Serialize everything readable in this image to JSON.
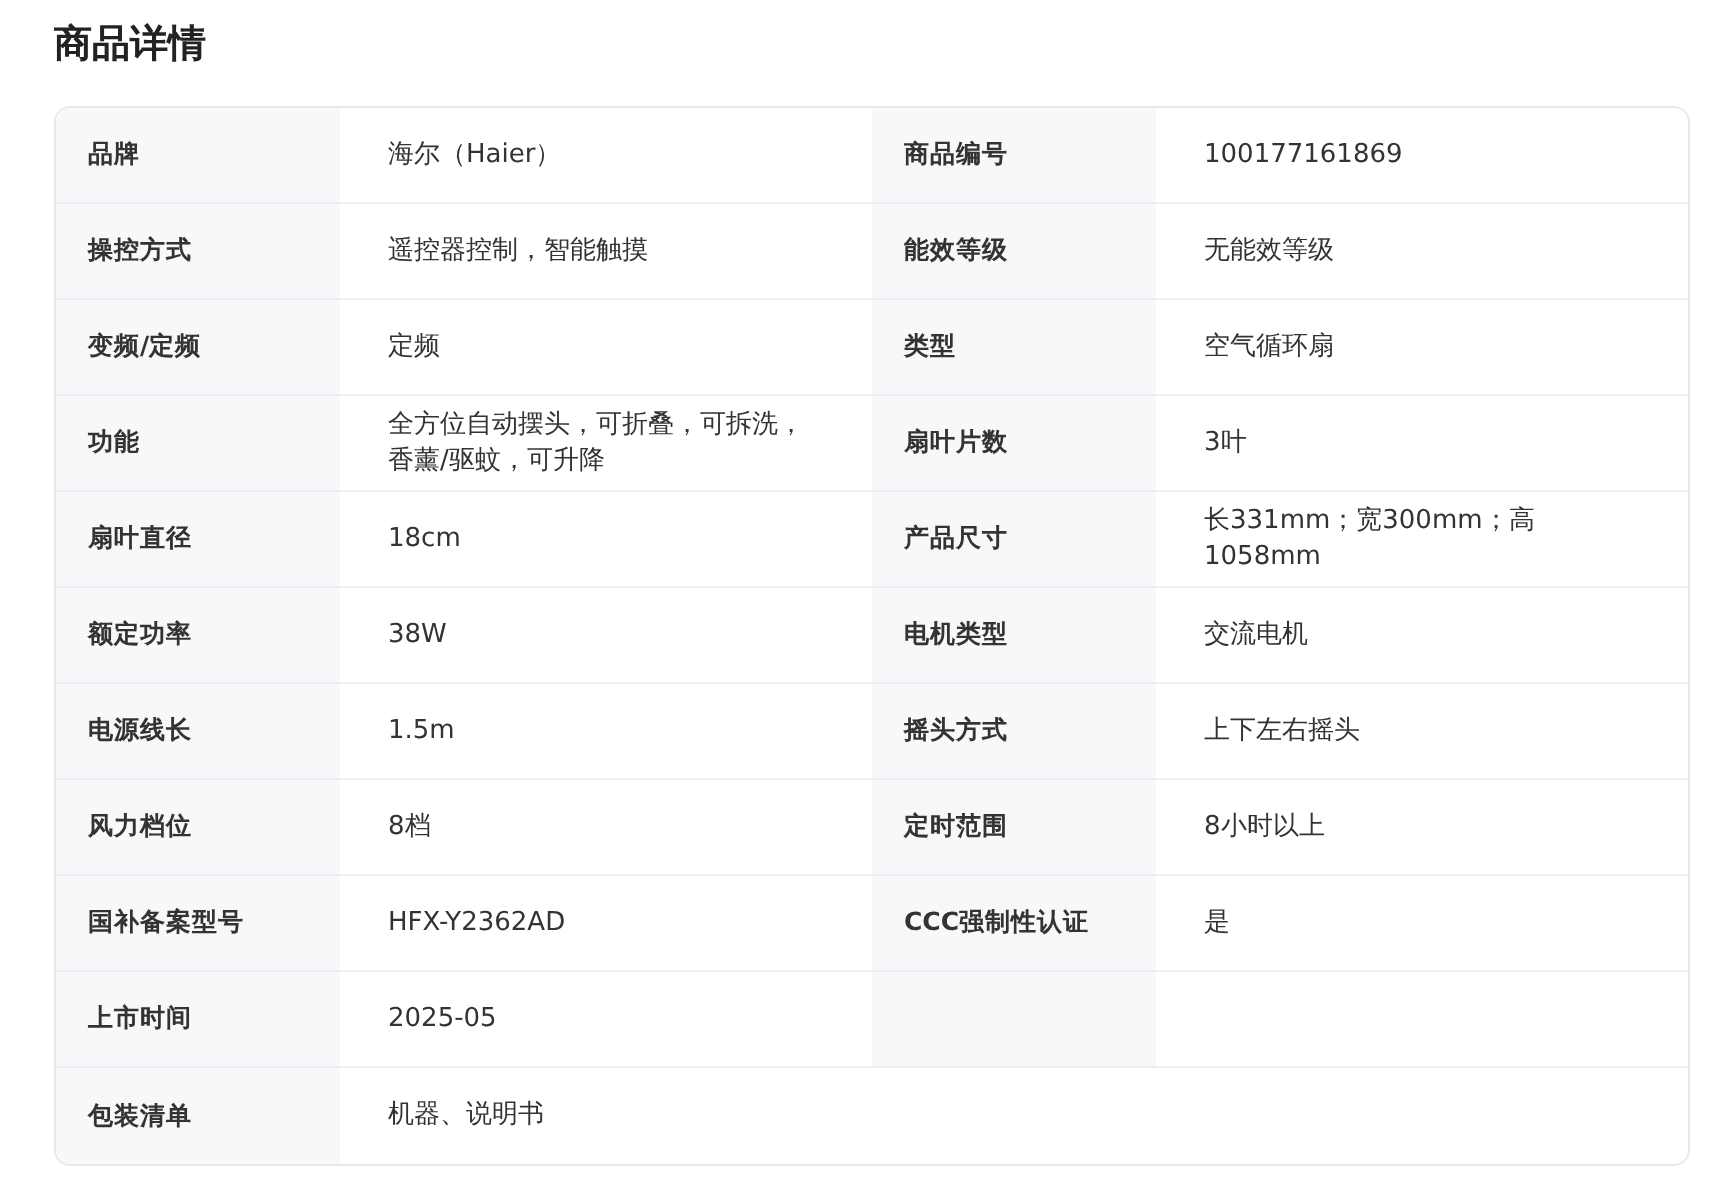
{
  "title": "商品详情",
  "rows": [
    {
      "kind": "pair",
      "cells": [
        {
          "label": "品牌",
          "value": "海尔（Haier）"
        },
        {
          "label": "商品编号",
          "value": "100177161869"
        }
      ]
    },
    {
      "kind": "pair",
      "cells": [
        {
          "label": "操控方式",
          "value": "遥控器控制，智能触摸"
        },
        {
          "label": "能效等级",
          "value": "无能效等级"
        }
      ]
    },
    {
      "kind": "pair",
      "cells": [
        {
          "label": "变频/定频",
          "value": "定频"
        },
        {
          "label": "类型",
          "value": "空气循环扇"
        }
      ]
    },
    {
      "kind": "pair",
      "cells": [
        {
          "label": "功能",
          "value": "全方位自动摆头，可折叠，可拆洗，香薰/驱蚊，可升降"
        },
        {
          "label": "扇叶片数",
          "value": "3叶"
        }
      ]
    },
    {
      "kind": "pair",
      "cells": [
        {
          "label": "扇叶直径",
          "value": "18cm"
        },
        {
          "label": "产品尺寸",
          "value": "长331mm；宽300mm；高1058mm"
        }
      ]
    },
    {
      "kind": "pair",
      "cells": [
        {
          "label": "额定功率",
          "value": "38W"
        },
        {
          "label": "电机类型",
          "value": "交流电机"
        }
      ]
    },
    {
      "kind": "pair",
      "cells": [
        {
          "label": "电源线长",
          "value": "1.5m"
        },
        {
          "label": "摇头方式",
          "value": "上下左右摇头"
        }
      ]
    },
    {
      "kind": "pair",
      "cells": [
        {
          "label": "风力档位",
          "value": "8档"
        },
        {
          "label": "定时范围",
          "value": "8小时以上"
        }
      ]
    },
    {
      "kind": "pair",
      "cells": [
        {
          "label": "国补备案型号",
          "value": "HFX-Y2362AD"
        },
        {
          "label": "CCC强制性认证",
          "value": "是"
        }
      ]
    },
    {
      "kind": "half",
      "cells": [
        {
          "label": "上市时间",
          "value": "2025-05"
        }
      ]
    },
    {
      "kind": "wide",
      "cells": [
        {
          "label": "包装清单",
          "value": "机器、说明书"
        }
      ]
    }
  ]
}
